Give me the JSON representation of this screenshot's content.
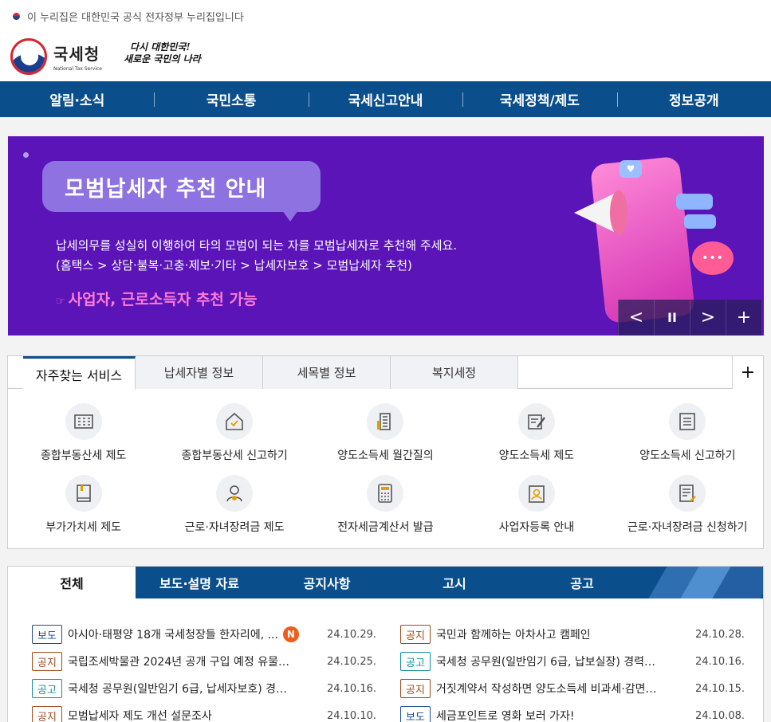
{
  "gov_notice": "이 누리집은 대한민국 공식 전자정부 누리집입니다",
  "logo": {
    "name": "국세청",
    "en": "National Tax Service"
  },
  "slogan": {
    "line1": "다시 대한민국!",
    "line2": "새로운 국민의 나라"
  },
  "nav": [
    "알림·소식",
    "국민소통",
    "국세신고안내",
    "국세정책/제도",
    "정보공개"
  ],
  "banner": {
    "title": "모범납세자 추천 안내",
    "desc1": "납세의무를 성실히 이행하여 타의 모범이 되는 자를 모범납세자로 추천해 주세요.",
    "desc2": "(홈택스 > 상담·불복·고충·제보·기타 > 납세자보호 > 모범납세자 추천)",
    "highlight": "사업자, 근로소득자 추천 가능",
    "controls": {
      "prev": "<",
      "pause": "II",
      "next": ">",
      "more": "+"
    }
  },
  "services": {
    "tabs": [
      "자주찾는 서비스",
      "납세자별 정보",
      "세목별 정보",
      "복지세정"
    ],
    "plus": "+",
    "items": [
      {
        "label": "종합부동산세 제도",
        "icon": "building-document-icon"
      },
      {
        "label": "종합부동산세 신고하기",
        "icon": "house-check-icon"
      },
      {
        "label": "양도소득세 월간질의",
        "icon": "document-building-icon"
      },
      {
        "label": "양도소득세 제도",
        "icon": "document-pen-icon"
      },
      {
        "label": "양도소득세 신고하기",
        "icon": "list-document-icon"
      },
      {
        "label": "부가가치세 제도",
        "icon": "book-icon"
      },
      {
        "label": "근로·자녀장려금 제도",
        "icon": "family-icon"
      },
      {
        "label": "전자세금계산서 발급",
        "icon": "calculator-icon"
      },
      {
        "label": "사업자등록 안내",
        "icon": "clipboard-user-icon"
      },
      {
        "label": "근로·자녀장려금 신청하기",
        "icon": "document-edit-icon"
      }
    ]
  },
  "news": {
    "tabs": [
      "전체",
      "보도·설명 자료",
      "공지사항",
      "고시",
      "공고"
    ],
    "rows": [
      [
        {
          "tag": "보도",
          "type": "bodo",
          "title": "아시아·태평양 18개 국세청장들 한자리에, ...",
          "new": "N",
          "date": "24.10.29."
        },
        {
          "tag": "공지",
          "type": "gongji",
          "title": "국민과 함께하는 아차사고 캠페인",
          "date": "24.10.28."
        }
      ],
      [
        {
          "tag": "공지",
          "type": "gongji",
          "title": "국립조세박물관 2024년 공개 구입 예정 유물 ...",
          "date": "24.10.25."
        },
        {
          "tag": "공고",
          "type": "gonggo",
          "title": "국세청 공무원(일반임기 6급, 납보실장) 경력경...",
          "date": "24.10.16."
        }
      ],
      [
        {
          "tag": "공고",
          "type": "gonggo",
          "title": "국세청 공무원(일반임기 6급, 납세자보호) 경력...",
          "date": "24.10.16."
        },
        {
          "tag": "공지",
          "type": "gongji",
          "title": "거짓계약서 작성하면 양도소득세 비과세·감면 ...",
          "date": "24.10.15."
        }
      ],
      [
        {
          "tag": "공지",
          "type": "gongji",
          "title": "모범납세자 제도 개선 설문조사",
          "date": "24.10.10."
        },
        {
          "tag": "보도",
          "type": "bodo",
          "title": "세금포인트로 영화 보러 가자!",
          "date": "24.10.08."
        }
      ]
    ]
  },
  "colors": {
    "nav_blue": "#0b4e8c",
    "banner_purple": "#5a14b8",
    "highlight_pink": "#ff7ad8",
    "new_badge": "#f05c1a"
  }
}
